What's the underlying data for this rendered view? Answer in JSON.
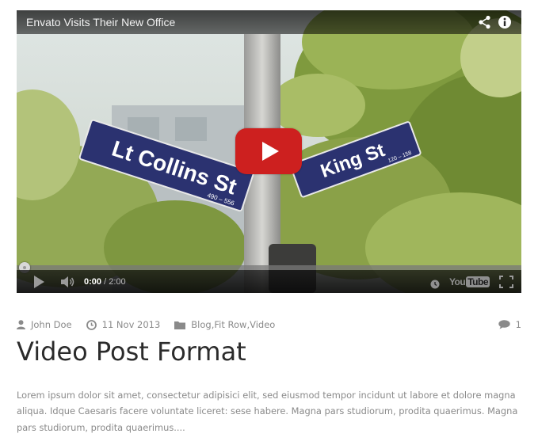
{
  "video": {
    "title": "Envato Visits Their New Office",
    "current_time": "0:00",
    "separator": " / ",
    "duration": "2:00",
    "progress": 0,
    "brand_colors": {
      "youtube_red": "#cd201f"
    },
    "logo": {
      "you": "You",
      "tube": "Tube"
    },
    "street_signs": {
      "left": "Lt Collins St",
      "left_range": "490 – 556",
      "right": "King St",
      "right_range": "120 – 158"
    },
    "icons": [
      "share-icon",
      "info-icon",
      "play-icon",
      "volume-icon",
      "clock-icon",
      "fullscreen-icon"
    ]
  },
  "post": {
    "author": "John Doe",
    "date": "11 Nov 2013",
    "categories": [
      "Blog",
      "Fit Row",
      "Video"
    ],
    "category_separator": ", ",
    "comment_count": "1",
    "title": "Video Post Format",
    "excerpt": "Lorem ipsum dolor sit amet, consectetur adipisici elit, sed eiusmod tempor incidunt ut labore et dolore magna aliqua. Idque Caesaris facere voluntate liceret: sese habere. Magna pars studiorum, prodita quaerimus. Magna pars studiorum, prodita quaerimus....",
    "icons": [
      "user-icon",
      "clock-icon",
      "folder-icon",
      "comment-icon"
    ]
  }
}
